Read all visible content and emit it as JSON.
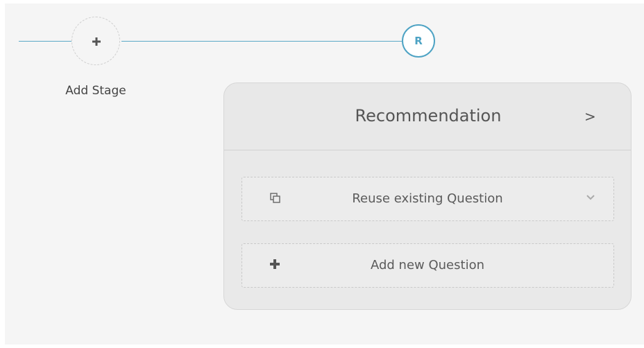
{
  "pipeline": {
    "add_stage_label": "Add Stage",
    "stage_letter": "R"
  },
  "stage_card": {
    "title": "Recommendation",
    "expand_glyph": ">",
    "reuse_question_label": "Reuse existing Question",
    "add_question_label": "Add new Question"
  },
  "icons": {
    "add_stage": "plus-icon",
    "copy": "copy-icon",
    "dropdown": "chevron-down-icon",
    "add_question": "plus-icon"
  },
  "colors": {
    "accent": "#4ea3c4",
    "background": "#f5f5f5",
    "card": "#e9e9e9"
  }
}
